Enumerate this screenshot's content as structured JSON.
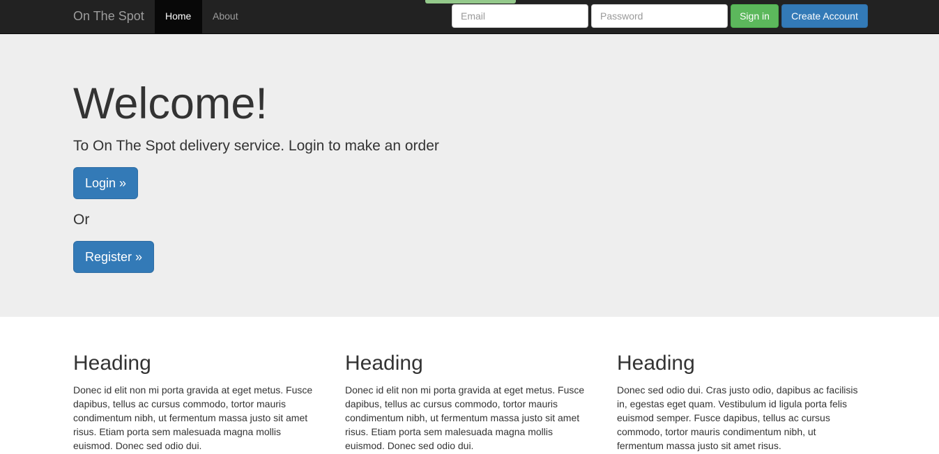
{
  "navbar": {
    "brand": "On The Spot",
    "links": [
      {
        "label": "Home",
        "active": true
      },
      {
        "label": "About",
        "active": false
      }
    ],
    "email_placeholder": "Email",
    "password_placeholder": "Password",
    "signin_label": "Sign in",
    "create_account_label": "Create Account"
  },
  "jumbotron": {
    "title": "Welcome!",
    "lead": "To On The Spot delivery service. Login to make an order",
    "login_label": "Login »",
    "or_text": "Or",
    "register_label": "Register »"
  },
  "columns": [
    {
      "heading": "Heading",
      "text": "Donec id elit non mi porta gravida at eget metus. Fusce dapibus, tellus ac cursus commodo, tortor mauris condimentum nibh, ut fermentum massa justo sit amet risus. Etiam porta sem malesuada magna mollis euismod. Donec sed odio dui."
    },
    {
      "heading": "Heading",
      "text": "Donec id elit non mi porta gravida at eget metus. Fusce dapibus, tellus ac cursus commodo, tortor mauris condimentum nibh, ut fermentum massa justo sit amet risus. Etiam porta sem malesuada magna mollis euismod. Donec sed odio dui."
    },
    {
      "heading": "Heading",
      "text": "Donec sed odio dui. Cras justo odio, dapibus ac facilisis in, egestas eget quam. Vestibulum id ligula porta felis euismod semper. Fusce dapibus, tellus ac cursus commodo, tortor mauris condimentum nibh, ut fermentum massa justo sit amet risus."
    }
  ],
  "colors": {
    "navbar_bg": "#222222",
    "jumbotron_bg": "#eeeeee",
    "primary": "#337ab7",
    "success": "#5cb85c"
  }
}
